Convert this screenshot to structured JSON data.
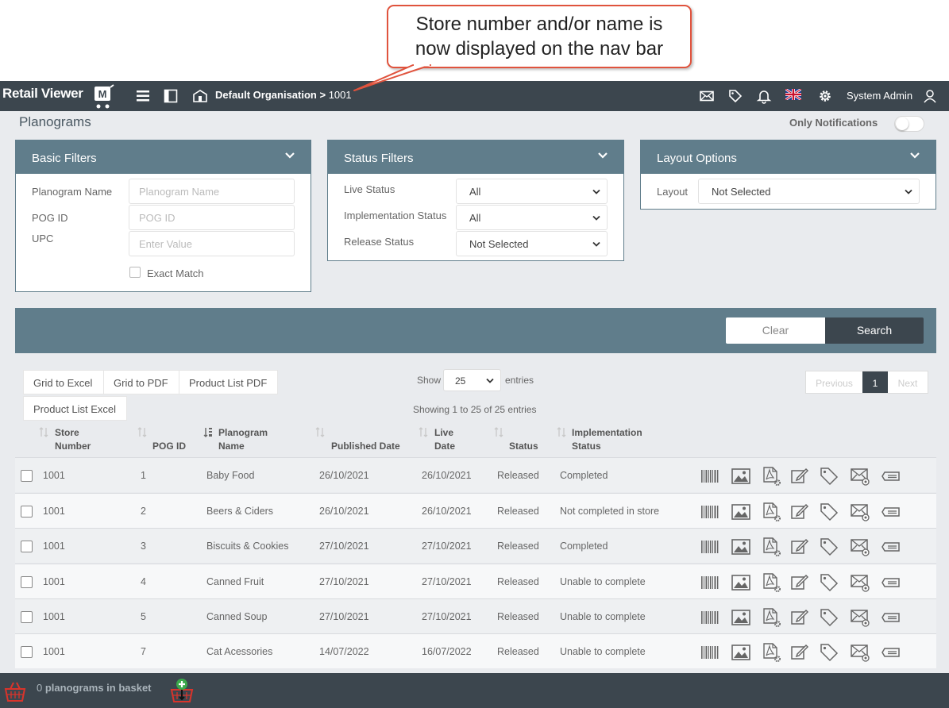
{
  "callout": {
    "line1": "Store number and/or name is",
    "line2": "now displayed on the nav bar"
  },
  "nav": {
    "brand": "Retail Viewer",
    "brand_mark": "M",
    "organisation": "Default Organisation >",
    "store": "1001",
    "user": "System Admin"
  },
  "page": {
    "title": "Planograms",
    "only_notifications_label": "Only Notifications",
    "only_notifications_on": false
  },
  "basic_filters": {
    "title": "Basic Filters",
    "planogram_name_label": "Planogram Name",
    "planogram_name_placeholder": "Planogram Name",
    "pog_id_label": "POG ID",
    "pog_id_placeholder": "POG ID",
    "upc_label": "UPC",
    "upc_placeholder": "Enter Value",
    "exact_match_label": "Exact Match"
  },
  "status_filters": {
    "title": "Status Filters",
    "live_status_label": "Live Status",
    "live_status_value": "All",
    "implementation_status_label": "Implementation Status",
    "implementation_status_value": "All",
    "release_status_label": "Release Status",
    "release_status_value": "Not Selected"
  },
  "layout_options": {
    "title": "Layout Options",
    "layout_label": "Layout",
    "layout_value": "Not Selected"
  },
  "search_bar": {
    "clear_label": "Clear",
    "search_label": "Search"
  },
  "export": {
    "grid_excel": "Grid to Excel",
    "grid_pdf": "Grid to PDF",
    "product_list_pdf": "Product List PDF",
    "product_list_excel": "Product List Excel"
  },
  "entries": {
    "show_label": "Show",
    "page_size": "25",
    "entries_label": "entries",
    "summary": "Showing 1 to 25 of 25 entries"
  },
  "pager": {
    "previous": "Previous",
    "current": "1",
    "next": "Next"
  },
  "table": {
    "headers": {
      "store_number_1": "Store",
      "store_number_2": "Number",
      "pog_id": "POG ID",
      "planogram_name_1": "Planogram",
      "planogram_name_2": "Name",
      "published_date": "Published Date",
      "live_date_1": "Live",
      "live_date_2": "Date",
      "status": "Status",
      "implementation_status_1": "Implementation",
      "implementation_status_2": "Status"
    },
    "rows": [
      {
        "store": "1001",
        "pog_id": "1",
        "name": "Baby Food",
        "published": "26/10/2021",
        "live": "26/10/2021",
        "status": "Released",
        "implementation": "Completed"
      },
      {
        "store": "1001",
        "pog_id": "2",
        "name": "Beers & Ciders",
        "published": "26/10/2021",
        "live": "26/10/2021",
        "status": "Released",
        "implementation": "Not completed in store"
      },
      {
        "store": "1001",
        "pog_id": "3",
        "name": "Biscuits & Cookies",
        "published": "27/10/2021",
        "live": "27/10/2021",
        "status": "Released",
        "implementation": "Completed"
      },
      {
        "store": "1001",
        "pog_id": "4",
        "name": "Canned Fruit",
        "published": "27/10/2021",
        "live": "27/10/2021",
        "status": "Released",
        "implementation": "Unable to complete"
      },
      {
        "store": "1001",
        "pog_id": "5",
        "name": "Canned Soup",
        "published": "27/10/2021",
        "live": "27/10/2021",
        "status": "Released",
        "implementation": "Unable to complete"
      },
      {
        "store": "1001",
        "pog_id": "7",
        "name": "Cat Acessories",
        "published": "14/07/2022",
        "live": "16/07/2022",
        "status": "Released",
        "implementation": "Unable to complete"
      }
    ],
    "row_action_icons": [
      "barcode-icon",
      "image-icon",
      "pdf-settings-icon",
      "edit-icon",
      "tag-icon",
      "mail-settings-icon",
      "label-icon"
    ]
  },
  "footer": {
    "basket_count": "0",
    "basket_text": "planograms in basket"
  },
  "colors": {
    "nav": "#3c464e",
    "panel_header": "#607d8b",
    "page_bg": "#e9ebee",
    "callout_border": "#e0533d"
  }
}
